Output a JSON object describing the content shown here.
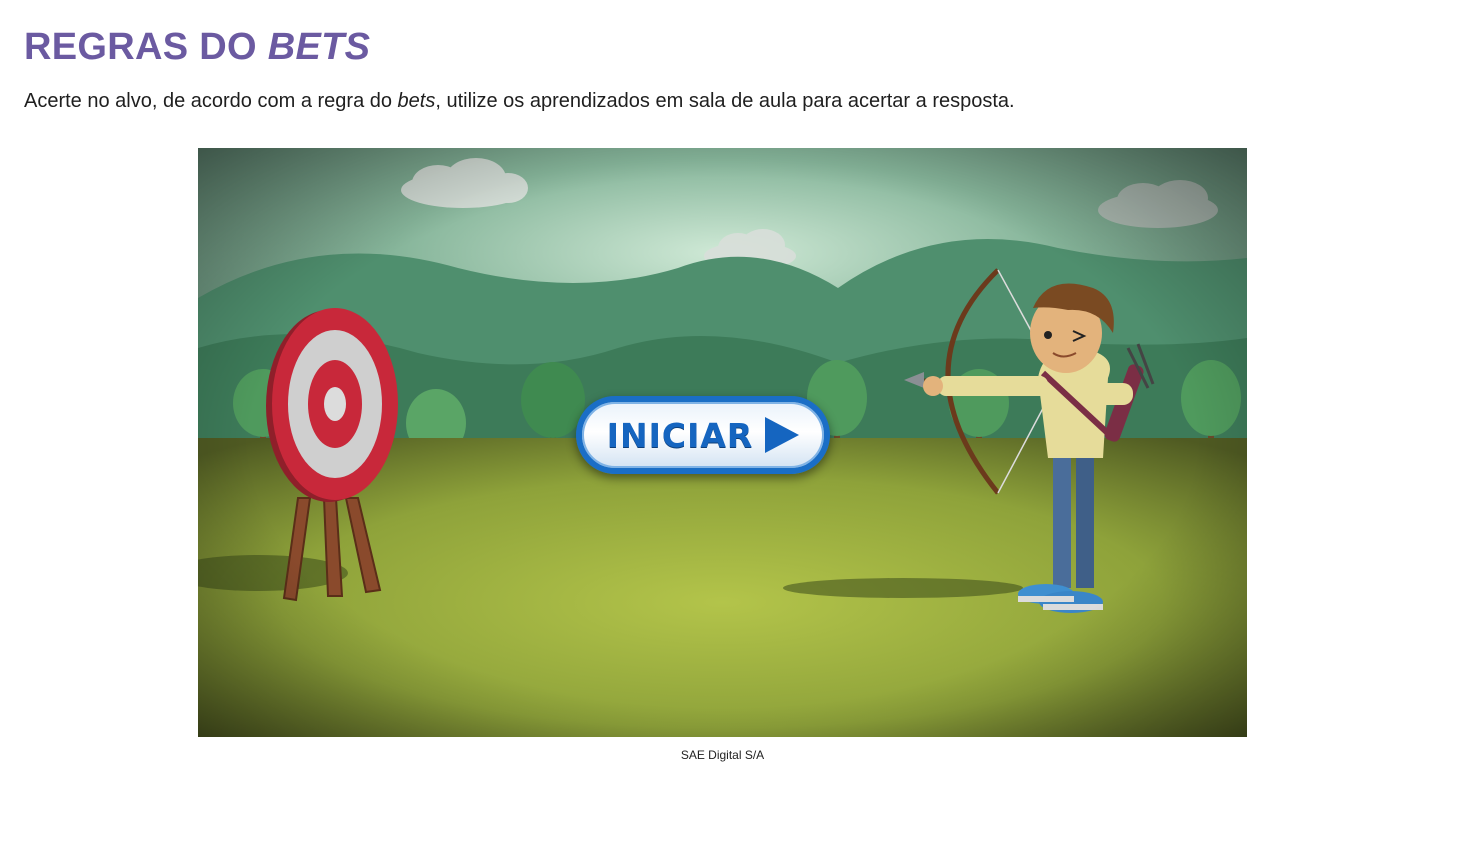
{
  "header": {
    "title_main": "REGRAS DO ",
    "title_em": "BETS"
  },
  "intro": {
    "text_before": "Acerte no alvo, de acordo com a regra do ",
    "text_em": "bets",
    "text_after": ", utilize os aprendizados em sala de aula para acertar a resposta."
  },
  "game": {
    "start_button_label": "INICIAR",
    "start_icon": "play-icon",
    "scene_icons": [
      "cloud-icon",
      "tree-icon",
      "target-icon",
      "archer-icon"
    ],
    "colors": {
      "sky_top": "#5e8a72",
      "sky_glow": "#b9dcc6",
      "hill_far": "#4f8f6e",
      "hill_near": "#3d7b59",
      "grass": "#a8bb45",
      "target_red": "#c8283a",
      "button_blue": "#1565c0"
    }
  },
  "credit": {
    "text": "SAE Digital S/A"
  }
}
